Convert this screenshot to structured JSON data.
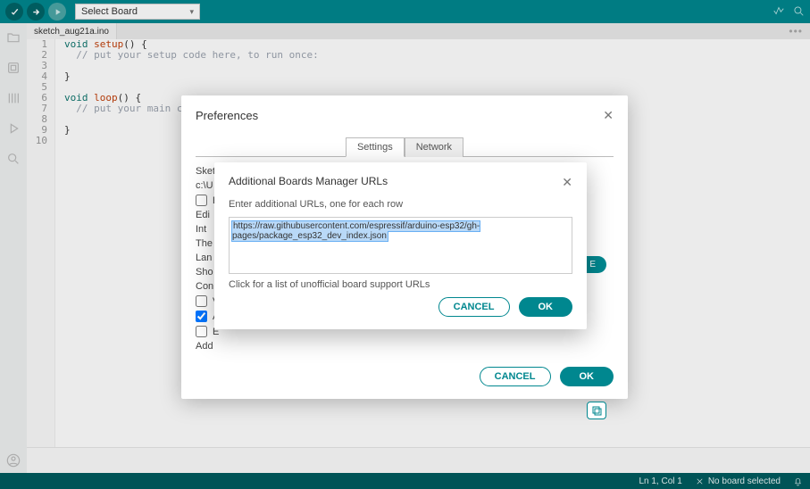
{
  "toolbar": {
    "board_placeholder": "Select Board"
  },
  "sidebar": {
    "icons": [
      "folder",
      "board",
      "library",
      "debug",
      "search"
    ]
  },
  "tab_name": "sketch_aug21a.ino",
  "editor": {
    "lines": [
      {
        "n": 1,
        "html": "<span class='kw'>void</span> <span class='fn'>setup</span>() {"
      },
      {
        "n": 2,
        "html": "  <span class='cmt'>// put your setup code here, to run once:</span>"
      },
      {
        "n": 3,
        "html": ""
      },
      {
        "n": 4,
        "html": "}"
      },
      {
        "n": 5,
        "html": ""
      },
      {
        "n": 6,
        "html": "<span class='kw'>void</span> <span class='fn'>loop</span>() {"
      },
      {
        "n": 7,
        "html": "  <span class='cmt'>// put your main code he</span>"
      },
      {
        "n": 8,
        "html": ""
      },
      {
        "n": 9,
        "html": "}"
      },
      {
        "n": 10,
        "html": ""
      }
    ]
  },
  "status": {
    "ln_col": "Ln 1, Col 1",
    "no_board": "No board selected"
  },
  "prefs": {
    "title": "Preferences",
    "tabs": {
      "settings": "Settings",
      "network": "Network"
    },
    "rows": {
      "sketchbook_label": "Sketchbook location:",
      "sketchbook_path": "c:\\U",
      "editor_font": "Edi",
      "interface": "Int",
      "theme": "The",
      "lang": "Lan",
      "show": "Sho",
      "compiler": "Con",
      "additional": "Add"
    },
    "checks": {
      "c1_label": "E",
      "c2_label": "V",
      "c3_label": "A",
      "c4_label": "E"
    },
    "browse": "E",
    "cancel": "CANCEL",
    "ok": "OK"
  },
  "urls": {
    "title": "Additional Boards Manager URLs",
    "hint": "Enter additional URLs, one for each row",
    "value": "https://raw.githubusercontent.com/espressif/arduino-esp32/gh-pages/package_esp32_dev_index.json",
    "link": "Click for a list of unofficial board support URLs",
    "cancel": "CANCEL",
    "ok": "OK"
  }
}
